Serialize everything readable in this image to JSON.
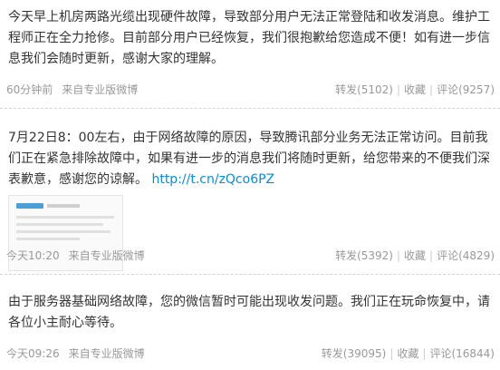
{
  "posts": [
    {
      "text": "今天早上机房两路光缆出现硬件故障，导致部分用户无法正常登陆和收发消息。维护工程师正在全力抢修。目前部分用户已经恢复，我们很抱歉给您造成不便！如有进一步信息我们会随时更新，感谢大家的理解。",
      "time": "60分钟前",
      "source": "来自专业版微博",
      "repost": "转发(5102)",
      "favorite": "收藏",
      "comment": "评论(9257)"
    },
    {
      "text": "7月22日8：00左右，由于网络故障的原因，导致腾讯部分业务无法正常访问。目前我们正在紧急排除故障中，如果有进一步的消息我们将随时更新，给您带来的不便我们深表歉意，感谢您的谅解。",
      "link": "http://t.cn/zQco6PZ",
      "time": "今天10:20",
      "source": "来自专业版微博",
      "repost": "转发(5392)",
      "favorite": "收藏",
      "comment": "评论(4829)"
    },
    {
      "text": "由于服务器基础网络故障，您的微信暂时可能出现收发问题。我们正在玩命恢复中，请各位小主耐心等待。",
      "time": "今天09:26",
      "source": "来自专业版微博",
      "repost": "转发(39095)",
      "favorite": "收藏",
      "comment": "评论(16844)"
    }
  ],
  "colors": {
    "text": "#333333",
    "meta": "#999999",
    "link": "#0a8cd2",
    "divider": "#d5d5d5"
  }
}
